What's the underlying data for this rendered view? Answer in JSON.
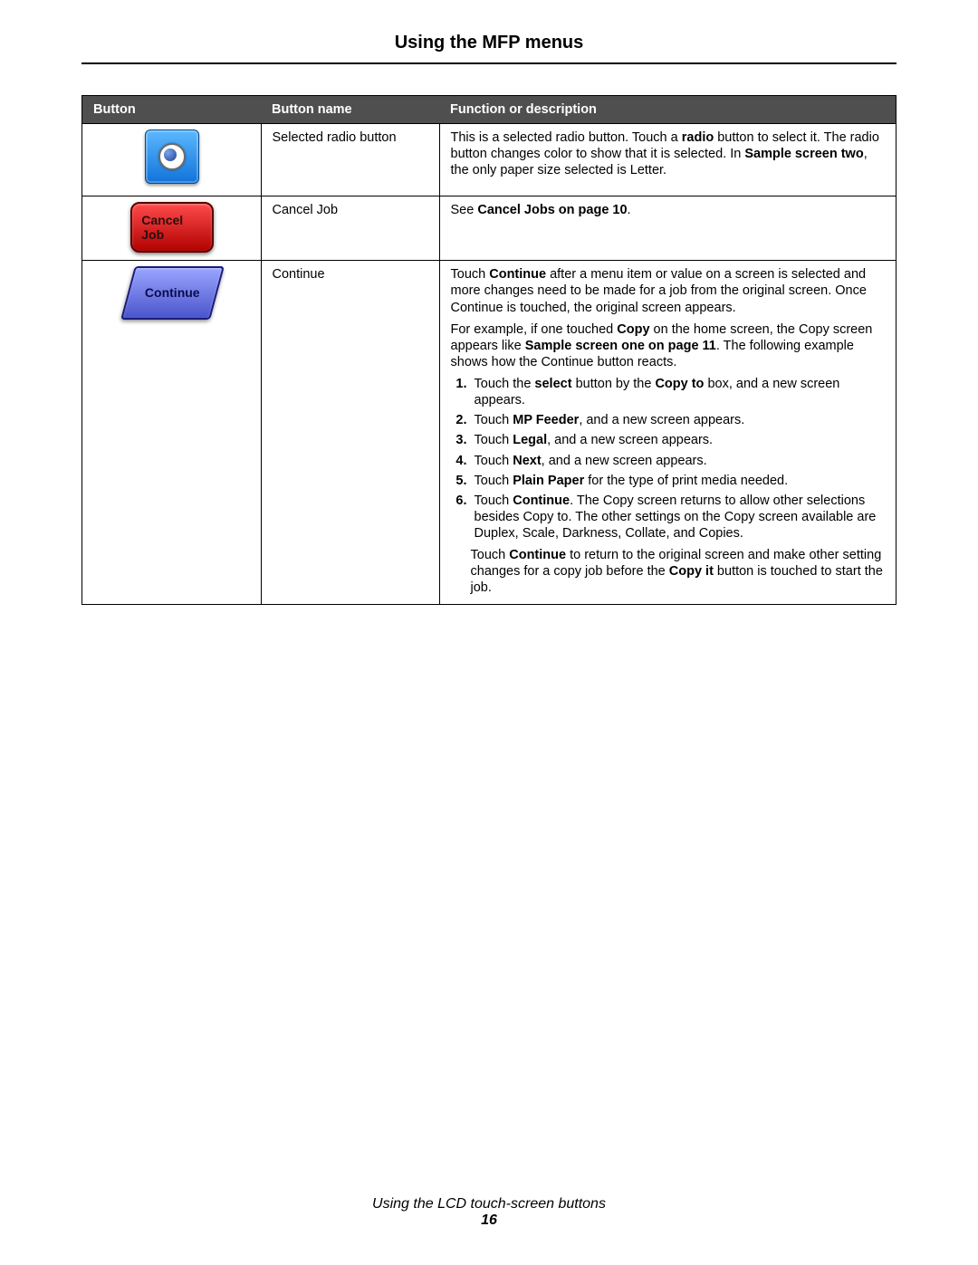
{
  "page_title": "Using the MFP menus",
  "footer_text": "Using the LCD touch-screen buttons",
  "page_number": "16",
  "columns": {
    "button": "Button",
    "name": "Button name",
    "desc": "Function or description"
  },
  "rows": {
    "radio": {
      "icon_label": "",
      "name": "Selected radio button",
      "desc": {
        "p1a": "This is a selected radio button. Touch a ",
        "p1b": "radio",
        "p1c": " button to select it. The radio button changes color to show that it is selected. In ",
        "p1d": "Sample screen two",
        "p1e": ", the only paper size selected is Letter."
      }
    },
    "cancel": {
      "icon_line1": "Cancel",
      "icon_line2": "Job",
      "name": "Cancel Job",
      "desc": {
        "a": "See ",
        "b": "Cancel Jobs on page 10",
        "c": "."
      }
    },
    "cont": {
      "icon_label": "Continue",
      "name": "Continue",
      "desc": {
        "p1a": "Touch ",
        "p1b": "Continue",
        "p1c": " after a menu item or value on a screen is selected and more changes need to be made for a job from the original screen. Once Continue is touched, the original screen appears.",
        "p2a": "For example, if one touched ",
        "p2b": "Copy",
        "p2c": " on the home screen, the Copy screen appears like ",
        "p2d": "Sample screen one on page 11",
        "p2e": ". The following example shows how the Continue button reacts.",
        "s1a": "Touch the ",
        "s1b": "select",
        "s1c": " button by the ",
        "s1d": "Copy to",
        "s1e": " box, and a new screen appears.",
        "s2a": "Touch ",
        "s2b": "MP Feeder",
        "s2c": ", and a new screen appears.",
        "s3a": "Touch ",
        "s3b": "Legal",
        "s3c": ", and a new screen appears.",
        "s4a": "Touch ",
        "s4b": "Next",
        "s4c": ", and a new screen appears.",
        "s5a": "Touch ",
        "s5b": "Plain Paper",
        "s5c": " for the type of print media needed.",
        "s6a": "Touch ",
        "s6b": "Continue",
        "s6c": ". The Copy screen returns to allow other selections besides Copy to. The other settings on the Copy screen available are Duplex, Scale, Darkness, Collate, and Copies.",
        "p3a": "Touch ",
        "p3b": "Continue",
        "p3c": " to return to the original screen and make other setting changes for a copy job before the ",
        "p3d": "Copy it",
        "p3e": " button is touched to start the job."
      }
    }
  }
}
